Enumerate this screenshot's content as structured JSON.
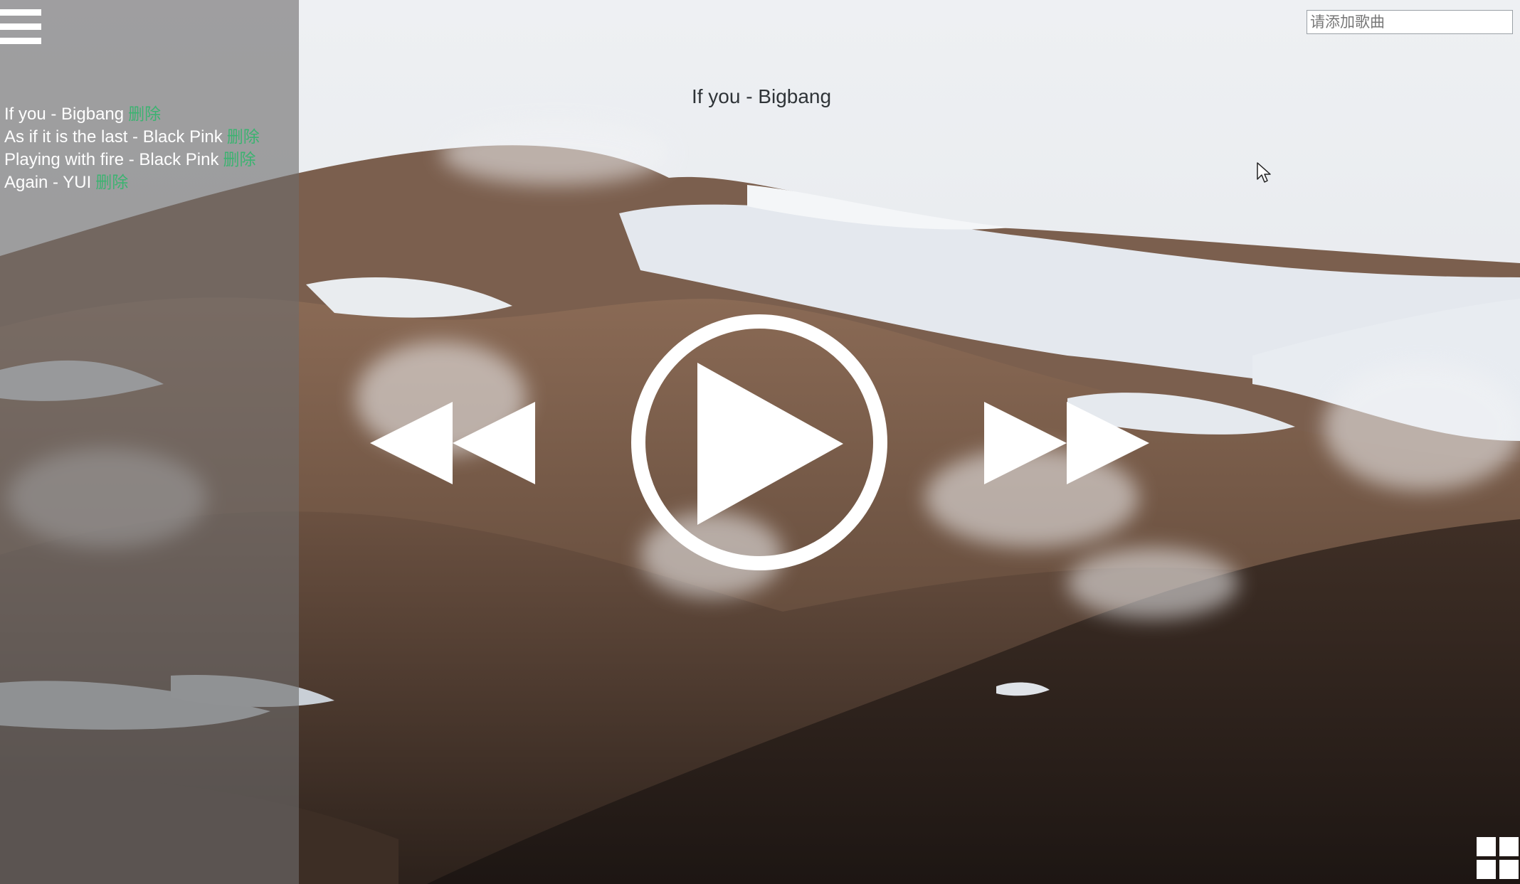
{
  "player": {
    "now_playing": "If you - Bigbang",
    "add_song_placeholder": "请添加歌曲"
  },
  "playlist": {
    "items": [
      {
        "title": "If you - Bigbang",
        "delete_label": "删除"
      },
      {
        "title": "As if it is the last - Black Pink",
        "delete_label": "删除"
      },
      {
        "title": "Playing with fire - Black Pink",
        "delete_label": "删除"
      },
      {
        "title": "Again - YUI",
        "delete_label": "删除"
      }
    ]
  },
  "icons": {
    "menu": "menu-icon",
    "prev": "rewind-icon",
    "play": "play-icon",
    "next": "fast-forward-icon",
    "grid": "grid-icon"
  },
  "colors": {
    "delete_link": "#3cb371",
    "title_text": "#2f3438",
    "sidebar_overlay": "#6e6c6c"
  }
}
